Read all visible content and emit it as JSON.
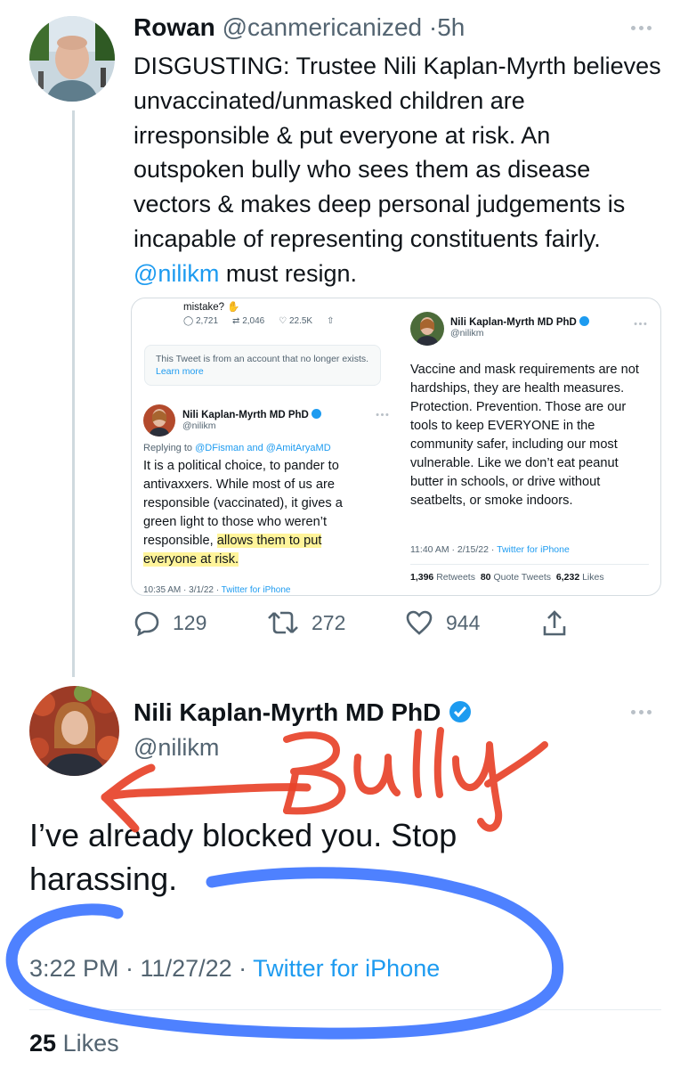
{
  "tweet1": {
    "name": "Rowan",
    "handle": "@canmericanized",
    "separator": "·",
    "time": "5h",
    "text_before": "DISGUSTING: Trustee Nili Kaplan-Myrth believes unvaccinated/unmasked children are irresponsible & put everyone at risk. An outspoken bully who sees them as disease vectors & makes deep personal judgements is incapable of representing constituents fairly. ",
    "mention": "@nilikm",
    "text_after": " must resign.",
    "embed": {
      "left_panel": {
        "mistake_text": "mistake? ✋",
        "reply_count": "2,721",
        "retweet_count": "2,046",
        "like_count": "22.5K",
        "notice_text": "This Tweet is from an account that no longer exists.",
        "notice_link": "Learn more",
        "author_name": "Nili Kaplan-Myrth MD PhD",
        "author_handle": "@nilikm",
        "replying_prefix": "Replying to",
        "replying_to": "@DFisman and @AmitAryaMD",
        "text_before": "It is a political choice, to pander to antivaxxers. While most of us are responsible (vaccinated), it gives a green light to those who weren’t responsible, ",
        "text_highlight": "allows them to put everyone at risk.",
        "footer_time": "10:35 AM · 3/1/22 ·",
        "footer_source": "Twitter for iPhone"
      },
      "right_panel": {
        "author_name": "Nili Kaplan-Myrth MD PhD",
        "author_handle": "@nilikm",
        "text": "Vaccine and mask requirements are not hardships, they are health measures. Protection. Prevention. Those are our tools to keep EVERYONE in the community safer, including our most vulnerable. Like we don’t eat peanut butter in schools, or drive without seatbelts, or smoke indoors.",
        "footer_time": "11:40 AM · 2/15/22 ·",
        "footer_source": "Twitter for iPhone",
        "retweets_count": "1,396",
        "retweets_label": "Retweets",
        "quotes_count": "80",
        "quotes_label": "Quote Tweets",
        "likes_count": "6,232",
        "likes_label": "Likes"
      }
    },
    "actions": {
      "replies": "129",
      "retweets": "272",
      "likes": "944"
    }
  },
  "tweet2": {
    "name": "Nili Kaplan-Myrth MD PhD",
    "handle": "@nilikm",
    "text": "I’ve already blocked you. Stop harassing.",
    "time": "3:22 PM · 11/27/22 ·",
    "source": "Twitter for iPhone",
    "likes_count": "25",
    "likes_label": "Likes"
  },
  "annotation": {
    "scrawl_text": "Bully",
    "red_color": "#e8432a",
    "blue_color": "#2f6bff"
  },
  "colors": {
    "link": "#1d9bf0",
    "text": "#0f1419",
    "muted": "#536471",
    "verified": "#1d9bf0"
  }
}
